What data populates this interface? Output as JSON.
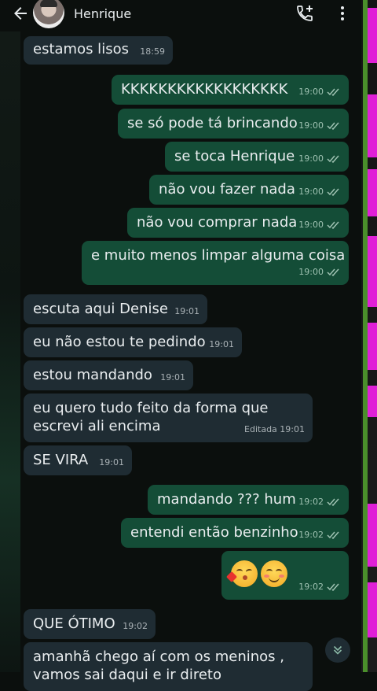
{
  "header": {
    "contact_name": "Henrique"
  },
  "messages": [
    {
      "text": "estamos lisos",
      "time": "18:59"
    },
    {
      "text": "KKKKKKKKKKKKKKKKKK",
      "time": "19:00"
    },
    {
      "text": "se só pode tá brincando",
      "time": "19:00"
    },
    {
      "text": "se toca Henrique",
      "time": "19:00"
    },
    {
      "text": "não vou fazer nada",
      "time": "19:00"
    },
    {
      "text": "não vou comprar nada",
      "time": "19:00"
    },
    {
      "text": "e muito menos limpar alguma coisa",
      "time": "19:00"
    },
    {
      "text": "escuta aqui Denise",
      "time": "19:01"
    },
    {
      "text": "eu não estou te pedindo",
      "time": "19:01"
    },
    {
      "text": "estou mandando",
      "time": "19:01"
    },
    {
      "text": "eu quero tudo feito da forma que\nescrevi ali encima",
      "time": "Editada 19:01"
    },
    {
      "text": "SE VIRA",
      "time": "19:01"
    },
    {
      "text": "mandando ??? hum",
      "time": "19:02"
    },
    {
      "text": "entendi então benzinho",
      "time": "19:02"
    },
    {
      "text": "",
      "time": "19:02"
    },
    {
      "text": "QUE ÓTIMO",
      "time": "19:02"
    },
    {
      "text": "amanhã chego aí com os meninos ,\nvamos sai daqui e ir direto",
      "time": ""
    }
  ]
}
